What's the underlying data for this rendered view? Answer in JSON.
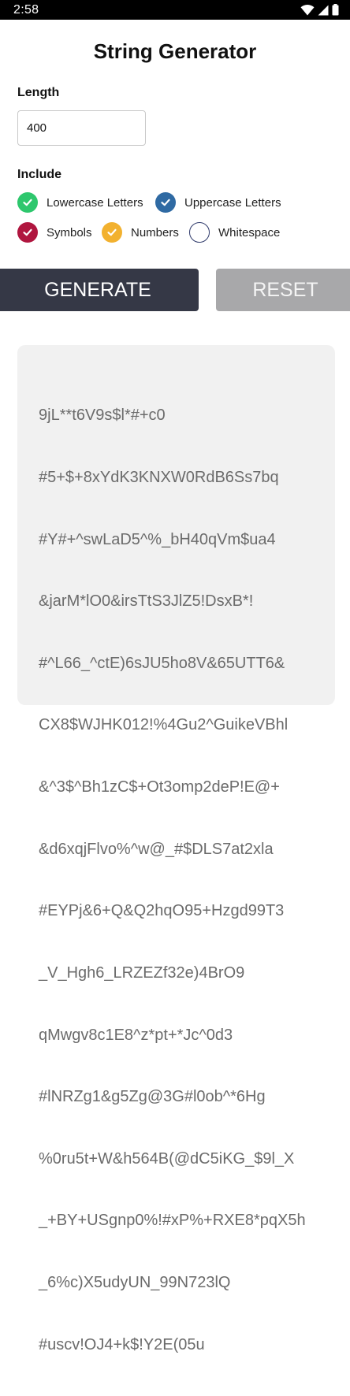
{
  "status_bar": {
    "time": "2:58",
    "icons": [
      "wifi-icon",
      "signal-icon",
      "battery-icon"
    ]
  },
  "title": "String Generator",
  "length": {
    "label": "Length",
    "value": "400"
  },
  "include": {
    "label": "Include",
    "options": [
      {
        "label": "Lowercase Letters",
        "checked": true,
        "color": "#2ec76d"
      },
      {
        "label": "Uppercase Letters",
        "checked": true,
        "color": "#2f6aa3"
      },
      {
        "label": "Symbols",
        "checked": true,
        "color": "#b0163f"
      },
      {
        "label": "Numbers",
        "checked": true,
        "color": "#f2b12f"
      },
      {
        "label": "Whitespace",
        "checked": false,
        "color": "#2f3a6b"
      }
    ]
  },
  "buttons": {
    "generate": "GENERATE",
    "reset": "RESET"
  },
  "output": {
    "lines": [
      "9jL**t6V9s$l*#+c0",
      "#5+$+8xYdK3KNXW0RdB6Ss7bq",
      "#Y#+^swLaD5^%_bH40qVm$ua4",
      "&jarM*lO0&irsTtS3JlZ5!DsxB*!",
      "#^L66_^ctE)6sJU5ho8V&65UTT6&",
      "CX8$WJHK012!%4Gu2^GuikeVBhl",
      "&^3$^Bh1zC$+Ot3omp2deP!E@+",
      "&d6xqjFlvo%^w@_#$DLS7at2xla",
      "#EYPj&6+Q&Q2hqO95+Hzgd99T3",
      "_V_Hgh6_LRZEZf32e)4BrO9",
      "qMwgv8c1E8^z*pt+*Jc^0d3",
      "#lNRZg1&g5Zg@3G#l0ob^*6Hg",
      "%0ru5t+W&h564B(@dC5iKG_$9l_X",
      "_+BY+USgnp0%!#xP%+RXE8*pqX5h",
      "_6%c)X5udyUN_99N723lQ",
      "#uscv!OJ4+k$!Y2E(05u"
    ]
  }
}
